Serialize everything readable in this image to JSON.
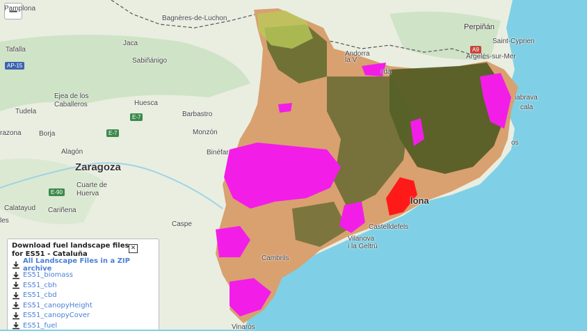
{
  "map": {
    "zoom_out_symbol": "−",
    "region_colors": {
      "sea": "#7fd0e6",
      "land": "#e9eee1",
      "forest": "#c8dfc0",
      "fuel_tan": "#d9a070",
      "fuel_olive": "#4e5a21",
      "fuel_magenta": "#f21ee8",
      "fuel_red": "#ff1a1a"
    },
    "labels": [
      {
        "name": "Pamplona",
        "text": "Pamplona"
      },
      {
        "name": "Bagneres",
        "text": "Bagnères-de-Luchon"
      },
      {
        "name": "Perpignan",
        "text": "Perpiñán"
      },
      {
        "name": "SaintCyprien",
        "text": "Saint-Cyprien"
      },
      {
        "name": "Argeles",
        "text": "Argelès-sur-Mer"
      },
      {
        "name": "Tafalla",
        "text": "Tafalla"
      },
      {
        "name": "Jaca",
        "text": "Jaca"
      },
      {
        "name": "Sabinanigo",
        "text": "Sabiñánigo"
      },
      {
        "name": "Andorra",
        "text": "Andorra\nla V"
      },
      {
        "name": "Urgell",
        "text": "rdà"
      },
      {
        "name": "Ejea",
        "text": "Ejea de los\nCaballeros"
      },
      {
        "name": "Huesca",
        "text": "Huesca"
      },
      {
        "name": "Barbastro",
        "text": "Barbastro"
      },
      {
        "name": "Tudela",
        "text": "Tudela"
      },
      {
        "name": "Tarazona",
        "text": "razona"
      },
      {
        "name": "Borja",
        "text": "Borja"
      },
      {
        "name": "Monzon",
        "text": "Monzón"
      },
      {
        "name": "Binefar",
        "text": "Binéfar"
      },
      {
        "name": "Alagon",
        "text": "Alagón"
      },
      {
        "name": "Zaragoza",
        "text": "Zaragoza"
      },
      {
        "name": "Cuarte",
        "text": "Cuarte de\nHuerva"
      },
      {
        "name": "Calatayud",
        "text": "Calatayud"
      },
      {
        "name": "Carinena",
        "text": "Cariñena"
      },
      {
        "name": "Caspe",
        "text": "Caspe"
      },
      {
        "name": "Figueres",
        "text": "iabrava"
      },
      {
        "name": "Escala",
        "text": "cala"
      },
      {
        "name": "Tossa",
        "text": "os"
      },
      {
        "name": "Barcelona",
        "text": "lona"
      },
      {
        "name": "Castelldefels",
        "text": "Castelldefels"
      },
      {
        "name": "Vilanova",
        "text": "Vilanova\ni la Geltrú"
      },
      {
        "name": "Cambrils",
        "text": "Cambrils"
      },
      {
        "name": "Vinaros",
        "text": "Vinaròs"
      },
      {
        "name": "Siles",
        "text": "les"
      }
    ],
    "roads": [
      {
        "name": "AP-15",
        "text": "AP-15"
      },
      {
        "name": "E-7a",
        "text": "E-7"
      },
      {
        "name": "E-7b",
        "text": "E-7"
      },
      {
        "name": "E-90",
        "text": "E-90"
      },
      {
        "name": "A9",
        "text": "A9"
      }
    ]
  },
  "panel": {
    "title": "Download fuel landscape files for ES51 - Cataluña",
    "close_symbol": "✕",
    "items": [
      {
        "label": "All Landscape Files in a ZIP archive"
      },
      {
        "label": "ES51_biomass"
      },
      {
        "label": "ES51_cbh"
      },
      {
        "label": "ES51_cbd"
      },
      {
        "label": "ES51_canopyHeight"
      },
      {
        "label": "ES51_canopyCover"
      },
      {
        "label": "ES51_fuel"
      }
    ]
  }
}
